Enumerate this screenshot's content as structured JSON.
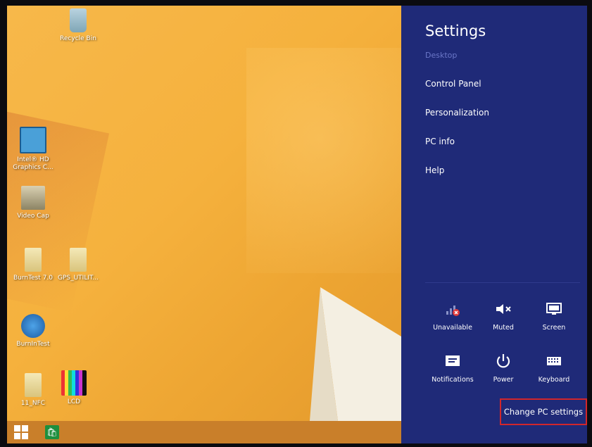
{
  "desktop": {
    "icons": [
      {
        "label": "Recycle Bin"
      },
      {
        "label": "Intel® HD\nGraphics C..."
      },
      {
        "label": "Video Cap"
      },
      {
        "label": "BurnTest 7.0"
      },
      {
        "label": "GPS_UTILIT..."
      },
      {
        "label": "BurnInTest"
      },
      {
        "label": "11_NFC"
      },
      {
        "label": "LCD"
      }
    ]
  },
  "taskbar": {
    "start_icon": "windows-logo-icon",
    "store_icon": "store-icon"
  },
  "settings": {
    "title": "Settings",
    "subtitle": "Desktop",
    "links": [
      "Control Panel",
      "Personalization",
      "PC info",
      "Help"
    ],
    "quick_settings": [
      {
        "label": "Unavailable",
        "icon": "network-unavailable-icon"
      },
      {
        "label": "Muted",
        "icon": "speaker-muted-icon"
      },
      {
        "label": "Screen",
        "icon": "screen-icon"
      },
      {
        "label": "Notifications",
        "icon": "notifications-icon"
      },
      {
        "label": "Power",
        "icon": "power-icon"
      },
      {
        "label": "Keyboard",
        "icon": "keyboard-icon"
      }
    ],
    "change_pc_settings": "Change PC settings",
    "colors": {
      "panel": "#1f2a78",
      "highlight": "#d1262b"
    }
  }
}
